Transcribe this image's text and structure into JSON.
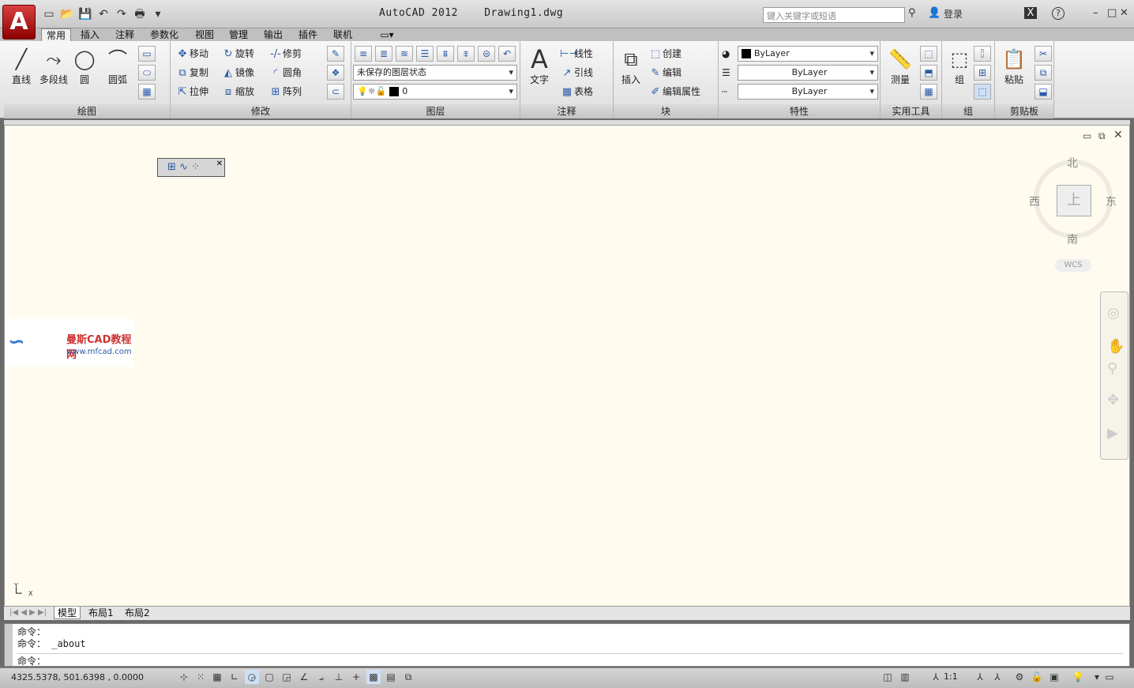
{
  "app": {
    "icon": "A",
    "title": "AutoCAD 2012",
    "doc": "Drawing1.dwg",
    "search_placeholder": "键入关键字或短语",
    "login": "登录",
    "help": "?"
  },
  "tabs": [
    "常用",
    "插入",
    "注释",
    "参数化",
    "视图",
    "管理",
    "输出",
    "插件",
    "联机"
  ],
  "panels": {
    "draw": "绘图",
    "modify": "修改",
    "layers": "图层",
    "annotation": "注释",
    "block": "块",
    "properties": "特性",
    "utilities": "实用工具",
    "groups": "组",
    "clipboard": "剪贴板"
  },
  "draw": {
    "line": "直线",
    "polyline": "多段线",
    "circle": "圆",
    "arc": "圆弧"
  },
  "modify": {
    "move": "移动",
    "rotate": "旋转",
    "trim": "修剪",
    "copy": "复制",
    "mirror": "镜像",
    "fillet": "圆角",
    "stretch": "拉伸",
    "scale": "缩放",
    "array": "阵列"
  },
  "layers": {
    "state": "未保存的图层状态",
    "current": "0"
  },
  "annotation": {
    "text": "文字",
    "linear": "线性",
    "leader": "引线",
    "table": "表格"
  },
  "block": {
    "insert": "插入",
    "create": "创建",
    "edit": "编辑",
    "edit_attr": "编辑属性"
  },
  "properties": {
    "color": "ByLayer",
    "lineweight": "ByLayer",
    "linetype": "ByLayer"
  },
  "utilities": {
    "measure": "测量"
  },
  "groups": {
    "group": "组"
  },
  "clipboard": {
    "paste": "粘贴"
  },
  "viewcube": {
    "north": "北",
    "south": "南",
    "east": "东",
    "west": "西",
    "top": "上",
    "wcs": "WCS"
  },
  "watermark": {
    "name": "曼斯CAD教程网",
    "url": "www.mfcad.com"
  },
  "ucs": {
    "x": "X",
    "y": "Y"
  },
  "layout_tabs": [
    "模型",
    "布局1",
    "布局2"
  ],
  "command": {
    "line1": "命令：",
    "line2": "命令： _about",
    "prompt": "命令："
  },
  "status": {
    "coords": "4325.5378, 501.6398 , 0.0000",
    "scale": "1:1"
  }
}
